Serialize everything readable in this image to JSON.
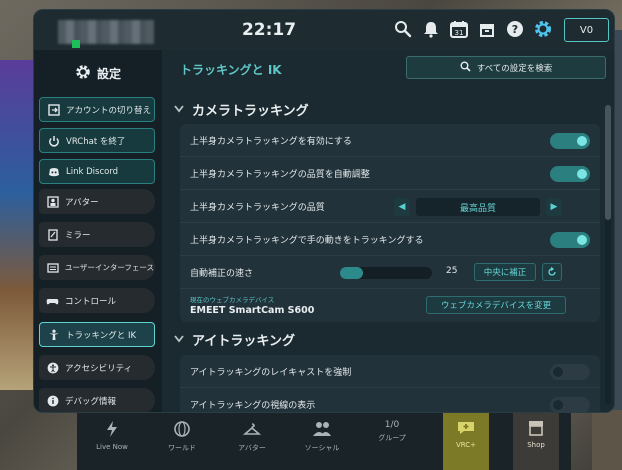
{
  "topbar": {
    "time": "22:17",
    "balance": "V0",
    "icons": [
      "search-icon",
      "bell-icon",
      "calendar-icon",
      "gift-box-icon",
      "help-icon",
      "gear-icon"
    ],
    "calendar_day": "31"
  },
  "sidebar": {
    "title": "設定",
    "items": [
      {
        "label": "アカウントの切り替え",
        "icon": "account-switch-icon"
      },
      {
        "label": "VRChat を終了",
        "icon": "power-icon"
      },
      {
        "label": "Link Discord",
        "icon": "discord-icon"
      },
      {
        "label": "アバター",
        "icon": "avatar-icon"
      },
      {
        "label": "ミラー",
        "icon": "mirror-icon"
      },
      {
        "label": "ユーザーインターフェース",
        "icon": "keyboard-icon"
      },
      {
        "label": "コントロール",
        "icon": "gamepad-icon"
      },
      {
        "label": "トラッキングと IK",
        "icon": "person-icon"
      },
      {
        "label": "アクセシビリティ",
        "icon": "accessibility-icon"
      },
      {
        "label": "デバッグ情報",
        "icon": "info-icon"
      }
    ]
  },
  "content": {
    "title": "トラッキングと IK",
    "search_label": "すべての設定を検索",
    "sections": {
      "camera": {
        "title": "カメラトラッキング",
        "rows": {
          "upper_body_enable": {
            "label": "上半身カメラトラッキングを有効にする",
            "on": true
          },
          "auto_quality": {
            "label": "上半身カメラトラッキングの品質を自動調整",
            "on": true
          },
          "quality": {
            "label": "上半身カメラトラッキングの品質",
            "value": "最高品質"
          },
          "hand_tracking": {
            "label": "上半身カメラトラッキングで手の動きをトラッキングする",
            "on": true
          },
          "auto_correct": {
            "label": "自動補正の速さ",
            "value": "25",
            "level": 0.25,
            "center_button": "中央に補正"
          },
          "webcam": {
            "caption": "現在のウェブカメラデバイス",
            "name": "EMEET SmartCam S600",
            "change_button": "ウェブカメラデバイスを変更"
          }
        }
      },
      "eye": {
        "title": "アイトラッキング",
        "rows": {
          "raycast": {
            "label": "アイトラッキングのレイキャストを強制",
            "on": false
          },
          "gaze": {
            "label": "アイトラッキングの視線の表示",
            "on": false
          }
        }
      }
    }
  },
  "dock": {
    "items": [
      {
        "label": "Live Now",
        "icon": "lightning-icon"
      },
      {
        "label": "ワールド",
        "icon": "globe-icon"
      },
      {
        "label": "アバター",
        "icon": "avatar-hanger-icon"
      },
      {
        "label": "ソーシャル",
        "icon": "people-icon"
      },
      {
        "label": "グループ",
        "icon": "group-icon",
        "badge": "1/0"
      },
      {
        "label": "VRC+",
        "icon": "vrc-plus-icon"
      },
      {
        "label": "Shop",
        "icon": "shop-icon"
      }
    ]
  }
}
